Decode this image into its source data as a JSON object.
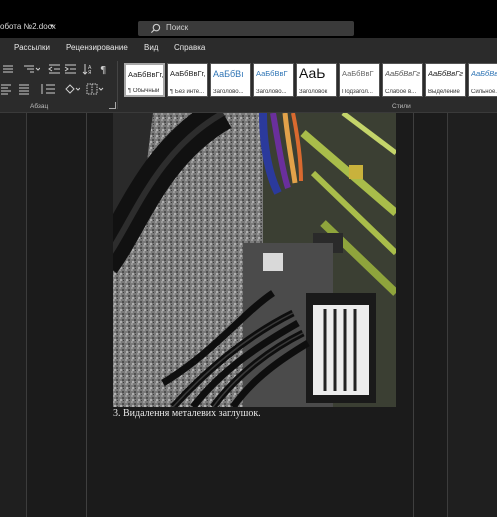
{
  "window": {
    "title": "обота №2.docx",
    "title_caret": "▾"
  },
  "search": {
    "placeholder": "Поиск"
  },
  "menu": {
    "items": [
      "Рассылки",
      "Рецензирование",
      "Вид",
      "Справка"
    ]
  },
  "ribbon": {
    "groups": {
      "paragraph": "Абзац",
      "styles": "Стили"
    },
    "styles": [
      {
        "sample": "АаБбВвГг,",
        "name": "¶ Обычный"
      },
      {
        "sample": "АаБбВвГг,",
        "name": "¶ Без инте..."
      },
      {
        "sample": "АаБбВı",
        "name": "Заголово..."
      },
      {
        "sample": "АаБбВвГ",
        "name": "Заголово..."
      },
      {
        "sample": "АаЬ",
        "name": "Заголовок"
      },
      {
        "sample": "АаБбВвГ",
        "name": "Подзагол..."
      },
      {
        "sample": "АаБбВвГг",
        "name": "Слабое в..."
      },
      {
        "sample": "АаБбВвГг",
        "name": "Выделение"
      },
      {
        "sample": "АаБбВвГе",
        "name": "Сильное..."
      }
    ]
  },
  "document": {
    "caption": "3. Видалення металевих заглушок."
  },
  "colors": {
    "titlebar": "#000000",
    "ribbon": "#2b2b2b",
    "canvas": "#1f1f1f",
    "heading_blue": "#2e74b5"
  }
}
